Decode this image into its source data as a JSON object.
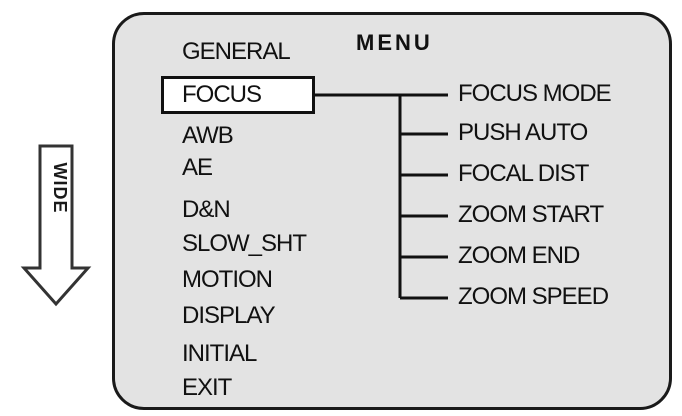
{
  "side_indicator": {
    "label": "WIDE"
  },
  "menu": {
    "title": "MENU",
    "items": [
      "GENERAL",
      "FOCUS",
      "AWB",
      "AE",
      "D&N",
      "SLOW_SHT",
      "MOTION",
      "DISPLAY",
      "INITIAL",
      "EXIT"
    ],
    "selected": "FOCUS"
  },
  "submenu": {
    "items": [
      "FOCUS MODE",
      "PUSH AUTO",
      "FOCAL DIST",
      "ZOOM START",
      "ZOOM END",
      "ZOOM SPEED"
    ]
  }
}
